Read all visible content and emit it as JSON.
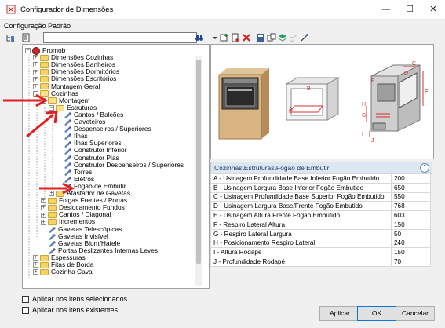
{
  "window": {
    "title": "Configurador de Dimensões",
    "minimize": "—",
    "maximize": "☐",
    "close": "✕"
  },
  "left_panel": {
    "label": "Configuração Padrão",
    "search_placeholder": "",
    "tree": [
      {
        "label": "Promob",
        "level": 0,
        "expand": "−",
        "icon": "root"
      },
      {
        "label": "Dimensões Cozinhas",
        "level": 1,
        "expand": "+",
        "icon": "folder"
      },
      {
        "label": "Dimensões Banheiros",
        "level": 1,
        "expand": "+",
        "icon": "folder"
      },
      {
        "label": "Dimensões Dormitórios",
        "level": 1,
        "expand": "+",
        "icon": "folder"
      },
      {
        "label": "Dimensões Escritórios",
        "level": 1,
        "expand": "+",
        "icon": "folder"
      },
      {
        "label": "Montagem Geral",
        "level": 1,
        "expand": "+",
        "icon": "folder"
      },
      {
        "label": "Cozinhas",
        "level": 1,
        "expand": "−",
        "icon": "folder"
      },
      {
        "label": "Montagem",
        "level": 2,
        "expand": "−",
        "icon": "folder"
      },
      {
        "label": "Estruturas",
        "level": 3,
        "expand": "−",
        "icon": "folder"
      },
      {
        "label": "Cantos / Balcões",
        "level": 4,
        "expand": "",
        "icon": "leaf"
      },
      {
        "label": "Gaveteiros",
        "level": 4,
        "expand": "",
        "icon": "leaf"
      },
      {
        "label": "Despenseiros / Superiores",
        "level": 4,
        "expand": "",
        "icon": "leaf"
      },
      {
        "label": "Ilhas",
        "level": 4,
        "expand": "",
        "icon": "leaf"
      },
      {
        "label": "Ilhas Superiores",
        "level": 4,
        "expand": "",
        "icon": "leaf"
      },
      {
        "label": "Construtor Inferior",
        "level": 4,
        "expand": "",
        "icon": "leaf"
      },
      {
        "label": "Construtor Pias",
        "level": 4,
        "expand": "",
        "icon": "leaf"
      },
      {
        "label": "Construtor Despenseiros / Superiores",
        "level": 4,
        "expand": "",
        "icon": "leaf"
      },
      {
        "label": "Torres",
        "level": 4,
        "expand": "",
        "icon": "leaf"
      },
      {
        "label": "Eletros",
        "level": 4,
        "expand": "",
        "icon": "leaf"
      },
      {
        "label": "Fogão de Embutir",
        "level": 4,
        "expand": "",
        "icon": "leaf"
      },
      {
        "label": "Afastador de Gavetas",
        "level": 3,
        "expand": "+",
        "icon": "folder"
      },
      {
        "label": "Folgas Frentes / Portas",
        "level": 2,
        "expand": "+",
        "icon": "folder"
      },
      {
        "label": "Deslocamento Fundos",
        "level": 2,
        "expand": "+",
        "icon": "folder"
      },
      {
        "label": "Cantos / Diagonal",
        "level": 2,
        "expand": "+",
        "icon": "folder"
      },
      {
        "label": "Incrementos",
        "level": 2,
        "expand": "+",
        "icon": "folder"
      },
      {
        "label": "Gavetas Telescópicas",
        "level": 2,
        "expand": "",
        "icon": "leaf"
      },
      {
        "label": "Gavetas Invisível",
        "level": 2,
        "expand": "",
        "icon": "leaf"
      },
      {
        "label": "Gavetas Blum/Hafele",
        "level": 2,
        "expand": "",
        "icon": "leaf"
      },
      {
        "label": "Portas Deslizantes Internas Leves",
        "level": 2,
        "expand": "",
        "icon": "leaf"
      },
      {
        "label": "Espessuras",
        "level": 1,
        "expand": "+",
        "icon": "folder"
      },
      {
        "label": "Fitas de Borda",
        "level": 1,
        "expand": "+",
        "icon": "folder"
      },
      {
        "label": "Cozinha Cava",
        "level": 1,
        "expand": "+",
        "icon": "folder"
      }
    ],
    "check_selected": "Aplicar nos itens selecionados",
    "check_existing": "Aplicar nos itens existentes"
  },
  "diagram_labels": {
    "A": "A",
    "B": "B",
    "C": "C",
    "D": "D",
    "E": "E",
    "F": "F",
    "G": "G",
    "H": "H",
    "I": "I",
    "J": "J"
  },
  "properties": {
    "path": "Cozinhas\\Estruturas\\Fogão de Embutir",
    "collapse_icon": "⌃",
    "rows": [
      {
        "label": "A - Usinagem Profundidade Base Inferior Fogão Embutido",
        "value": "200"
      },
      {
        "label": "B - Usinagem Largura Base Inferior Fogão Embutido",
        "value": "650"
      },
      {
        "label": "C - Usinagem Profundidade Base Superior Fogão Embutido",
        "value": "550"
      },
      {
        "label": "D - Usinagem Largura Base/Frente Fogão Embutido",
        "value": "768"
      },
      {
        "label": "E - Usinagem Altura Frente Fogão Embutido",
        "value": "603"
      },
      {
        "label": "F - Respiro Lateral Altura",
        "value": "150"
      },
      {
        "label": "G - Respiro Lateral Largura",
        "value": "50"
      },
      {
        "label": "H - Posicionamento Respiro Lateral",
        "value": "240"
      },
      {
        "label": "I - Altura Rodapé",
        "value": "150"
      },
      {
        "label": "J - Profundidade Rodapé",
        "value": "70"
      }
    ]
  },
  "buttons": {
    "apply": "Aplicar",
    "ok": "OK",
    "cancel": "Cancelar"
  }
}
